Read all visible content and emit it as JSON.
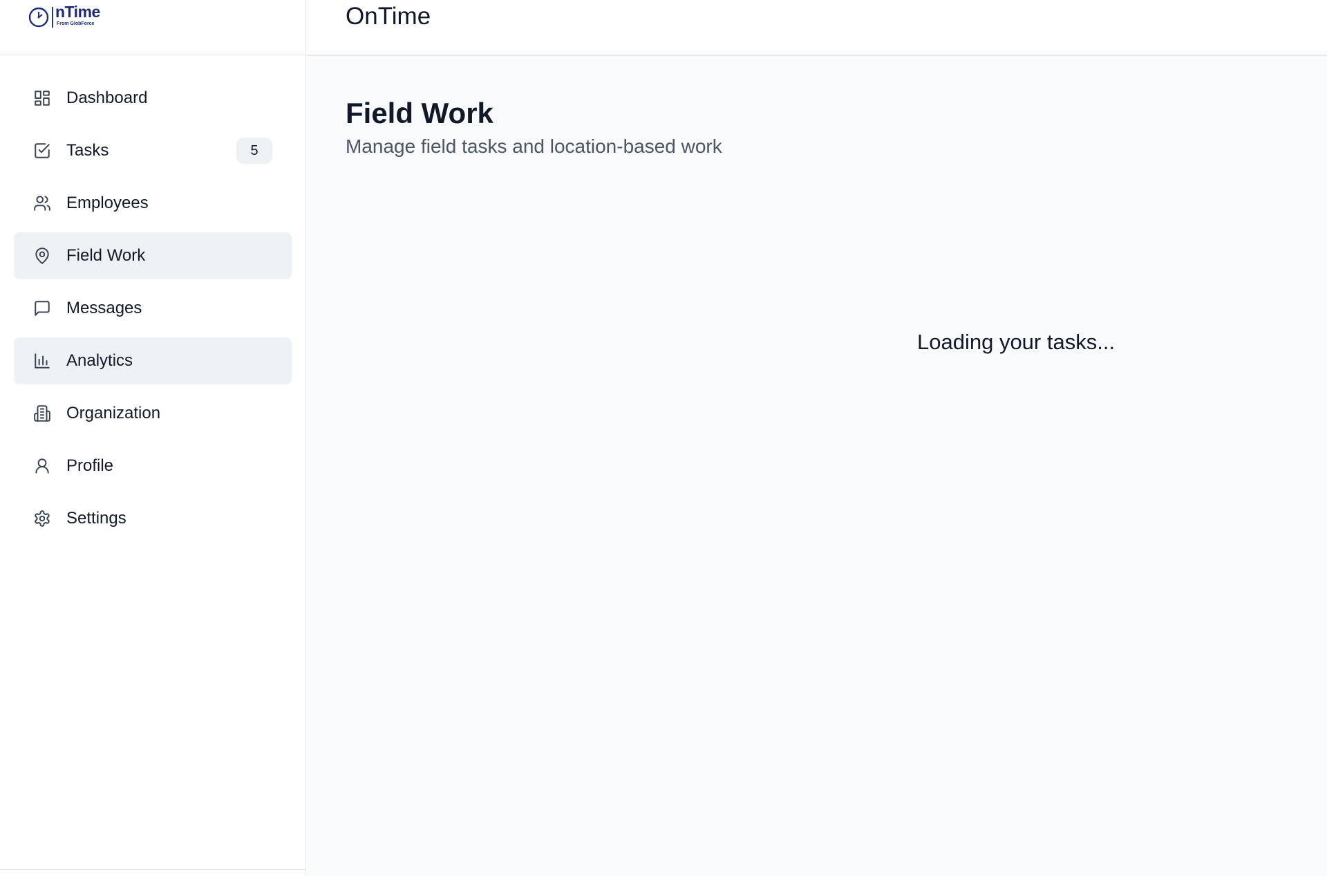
{
  "brand": {
    "logo_name": "nTime",
    "logo_sub": "From GlobForce"
  },
  "header": {
    "title": "OnTime"
  },
  "sidebar": {
    "items": [
      {
        "label": "Dashboard",
        "icon": "dashboard-icon"
      },
      {
        "label": "Tasks",
        "icon": "check-square-icon",
        "badge": "5"
      },
      {
        "label": "Employees",
        "icon": "users-icon"
      },
      {
        "label": "Field Work",
        "icon": "map-pin-icon",
        "active": true
      },
      {
        "label": "Messages",
        "icon": "message-icon"
      },
      {
        "label": "Analytics",
        "icon": "bar-chart-icon",
        "hover": true
      },
      {
        "label": "Organization",
        "icon": "building-icon"
      },
      {
        "label": "Profile",
        "icon": "user-icon"
      },
      {
        "label": "Settings",
        "icon": "gear-icon"
      }
    ]
  },
  "main": {
    "title": "Field Work",
    "subtitle": "Manage field tasks and location-based work",
    "loading": "Loading your tasks..."
  },
  "colors": {
    "brand": "#1e2a78",
    "active_bg": "#eef1f4",
    "page_bg": "#f8fafc"
  }
}
